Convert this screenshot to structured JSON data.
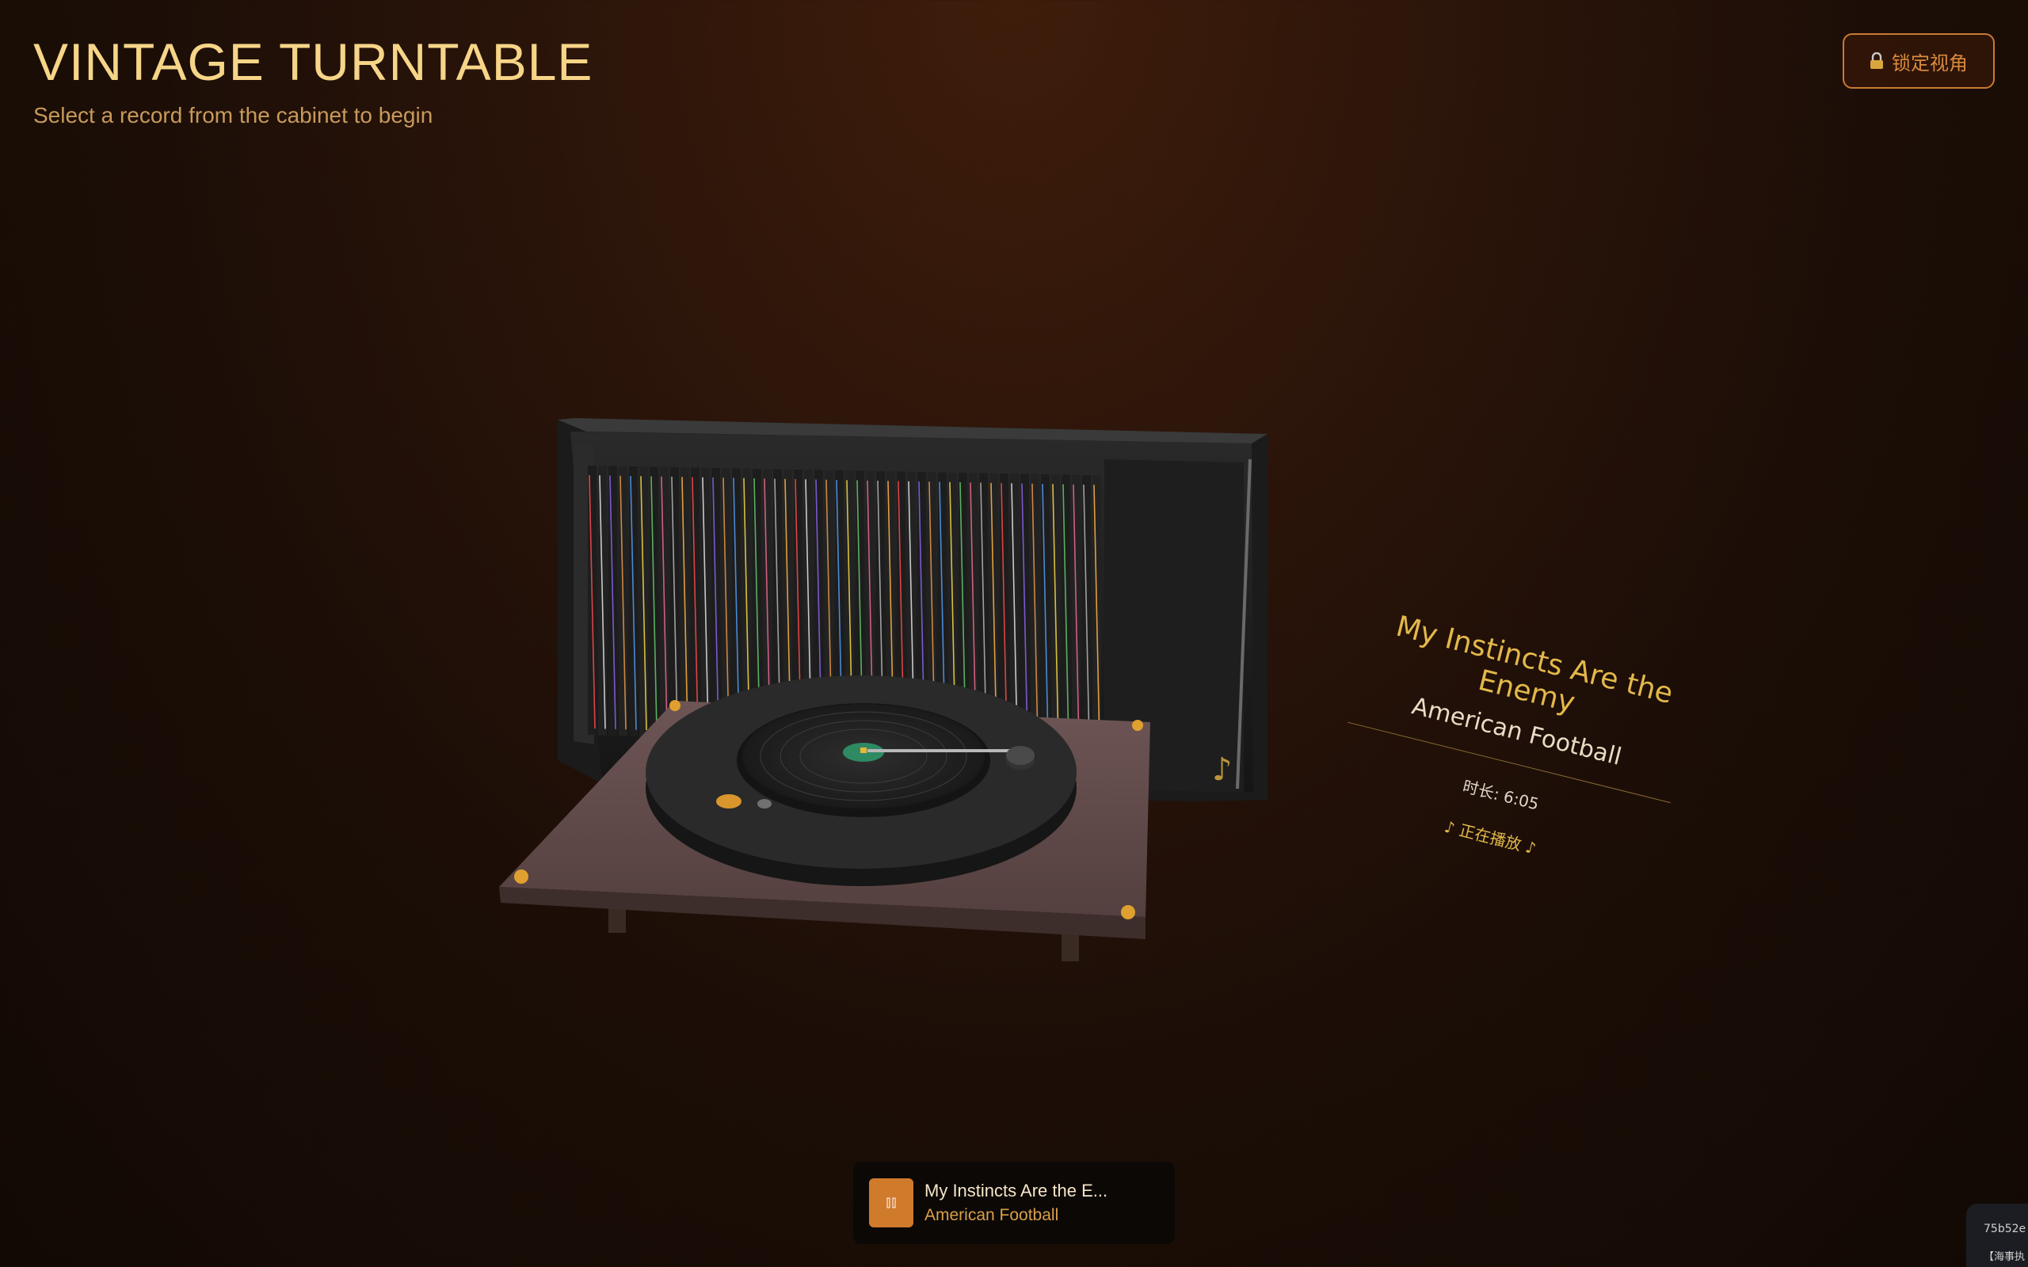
{
  "header": {
    "title": "VINTAGE TURNTABLE",
    "subtitle": "Select a record from the cabinet to begin"
  },
  "lock_button": {
    "label": "锁定视角",
    "icon": "lock-icon"
  },
  "cabinet": {
    "record_count": 50,
    "note_icon": "music-note-icon"
  },
  "now_playing_panel": {
    "song": "My Instincts Are the Enemy",
    "artist": "American Football",
    "duration": "时长: 6:05",
    "status": "♪ 正在播放 ♪"
  },
  "player_bar": {
    "song": "My Instincts Are the E...",
    "artist": "American Football",
    "button_icon": "pause-icon"
  },
  "corner_widget": {
    "line1": "75b52e",
    "line2": "【海事执"
  },
  "colors": {
    "accent": "#d07a2c",
    "gold": "#e3b84a",
    "title": "#f6d588",
    "background": "#1c0e07"
  }
}
